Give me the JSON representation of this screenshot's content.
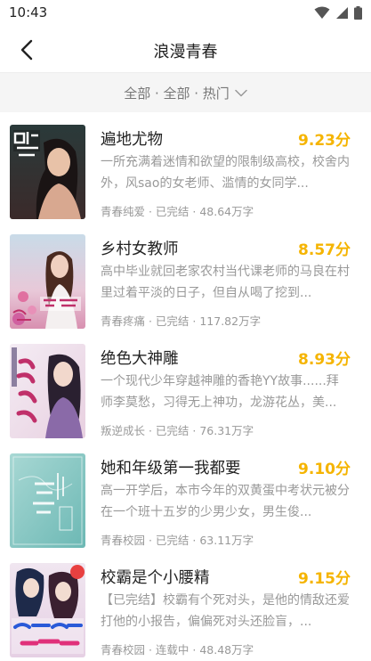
{
  "status_bar": {
    "time": "10:43"
  },
  "header": {
    "title": "浪漫青春"
  },
  "filter": {
    "label": "全部 · 全部 · 热门"
  },
  "colors": {
    "score": "#f5b400",
    "muted": "#999999",
    "filter_bg": "#f5f5f5"
  },
  "books": [
    {
      "title": "遍地尤物",
      "score": "9.23分",
      "desc": "一所充满着迷情和欲望的限制级高校，校舍内外，风sao的女老师、滥情的女同学...",
      "meta": "青春纯爱 · 已完结 · 48.64万字"
    },
    {
      "title": "乡村女教师",
      "score": "8.57分",
      "desc": "高中毕业就回老家农村当代课老师的马良在村里过着平淡的日子，但自从喝了挖到...",
      "meta": "青春疼痛 · 已完结 · 117.82万字"
    },
    {
      "title": "绝色大神雕",
      "score": "8.93分",
      "desc": "一个现代少年穿越神雕的香艳YY故事......拜师李莫愁，习得无上神功，龙游花丛，美...",
      "meta": "叛逆成长 · 已完结 · 76.31万字"
    },
    {
      "title": "她和年级第一我都要",
      "score": "9.10分",
      "desc": "高一开学后，本市今年的双黄蛋中考状元被分在一个班十五岁的少男少女，男生俊...",
      "meta": "青春校园 · 已完结 · 63.11万字"
    },
    {
      "title": "校霸是个小腰精",
      "score": "9.15分",
      "desc": "【已完结】校霸有个死对头，是他的情敌还爱打他的小报告，偏偏死对头还脸盲，...",
      "meta": "青春校园 · 连载中 · 48.48万字"
    }
  ]
}
